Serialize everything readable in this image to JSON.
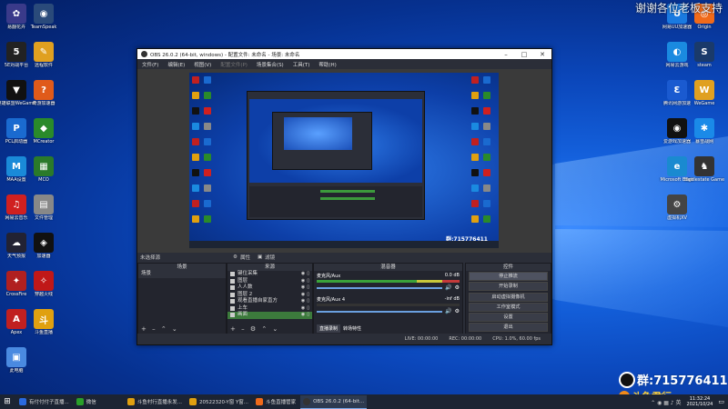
{
  "watermark": "谢谢各位老板支持",
  "left_icons": [
    {
      "label": "易翻花卉",
      "color": "#3a3a8a",
      "glyph": "✿"
    },
    {
      "label": "TeamSpeak",
      "color": "#2a4a7a",
      "glyph": "◉"
    },
    {
      "label": "5E对战平台",
      "color": "#222",
      "glyph": "5"
    },
    {
      "label": "远程软件",
      "color": "#e0a020",
      "glyph": "✎"
    },
    {
      "label": "英雄联盟WeGame",
      "color": "#111",
      "glyph": "▼"
    },
    {
      "label": "奇游加速器",
      "color": "#e05a1a",
      "glyph": "?"
    },
    {
      "label": "PCL启动器",
      "color": "#1a6ad0",
      "glyph": "P"
    },
    {
      "label": "MCreator",
      "color": "#2a8a2a",
      "glyph": "◆"
    },
    {
      "label": "MAA设置",
      "color": "#1a8ad8",
      "glyph": "M"
    },
    {
      "label": "MCO",
      "color": "#2a7a2a",
      "glyph": "▦"
    },
    {
      "label": "网易云音乐",
      "color": "#d02020",
      "glyph": "♫"
    },
    {
      "label": "文件管理",
      "color": "#888",
      "glyph": "▤"
    },
    {
      "label": "天气预报",
      "color": "#223",
      "glyph": "☁"
    },
    {
      "label": "加速器",
      "color": "#111",
      "glyph": "◈"
    },
    {
      "label": "CrossFire",
      "color": "#b02020",
      "glyph": "✦"
    },
    {
      "label": "穿越火线",
      "color": "#c01818",
      "glyph": "✧"
    },
    {
      "label": "Apex",
      "color": "#c02020",
      "glyph": "A"
    },
    {
      "label": "斗鱼直播",
      "color": "#e0a010",
      "glyph": "斗"
    },
    {
      "label": "此电脑",
      "color": "#4a8ae0",
      "glyph": "▣"
    }
  ],
  "right_icons": [
    {
      "label": "网易UU加速器",
      "color": "#1a7ae0",
      "glyph": "U"
    },
    {
      "label": "Origin",
      "color": "#f06a1a",
      "glyph": "◎"
    },
    {
      "label": "网易云游戏",
      "color": "#1a8ae0",
      "glyph": "◐"
    },
    {
      "label": "steam",
      "color": "#1a3a6a",
      "glyph": "S"
    },
    {
      "label": "腾讯网游加速",
      "color": "#1a5ad0",
      "glyph": "Ɛ"
    },
    {
      "label": "WeGame",
      "color": "#e0a020",
      "glyph": "W"
    },
    {
      "label": "爱游戏加速器",
      "color": "#111",
      "glyph": "◉"
    },
    {
      "label": "暴雪战网",
      "color": "#1a8ae8",
      "glyph": "✱"
    },
    {
      "label": "Microsoft Edge",
      "color": "#1a8ad0",
      "glyph": "e"
    },
    {
      "label": "Battlestate Games L...",
      "color": "#333",
      "glyph": "♞"
    },
    {
      "label": "虚拟机XV",
      "color": "#444",
      "glyph": "⚙"
    }
  ],
  "obs": {
    "title": "OBS 26.0.2 (64-bit, windows) - 配置文件: 未命名 - 场景: 未命名",
    "menu": [
      "文件(F)",
      "编辑(E)",
      "视图(V)",
      "配置文件(P)",
      "场景集合(S)",
      "工具(T)",
      "帮助(H)"
    ],
    "no_source": "未选择源",
    "props": "属性",
    "filters": "滤镜",
    "docks": {
      "scenes": "场景",
      "sources": "来源",
      "mixer": "混音器",
      "transitions": "转场",
      "controls": "控件"
    },
    "scenes": [
      "场景"
    ],
    "sources": [
      "键位采集",
      "图层",
      "人人数",
      "图层 2",
      "观看直播自家直方",
      "上车",
      "画面"
    ],
    "mixer": [
      {
        "name": "麦克风/Aux",
        "level": "0.0 dB"
      },
      {
        "name": "麦克风/Aux 4",
        "level": "-inf dB"
      }
    ],
    "mixer_tabs": [
      "直播录制",
      "转场特性"
    ],
    "controls": [
      "停止推流",
      "开始录制",
      "启动虚拟摄像机",
      "工作室模式",
      "设置",
      "退出"
    ],
    "status": {
      "live": "LIVE: 00:00:00",
      "rec": "REC: 00:00:00",
      "cpu": "CPU: 1.0%, 60.00 fps"
    }
  },
  "qq_overlay": "群:715776411",
  "douyu_overlay": "斗鱼君行",
  "taskbar": {
    "apps": [
      "有付付付子直播...",
      "微信",
      "斗鱼村行直播永发...",
      "20522320-Y窗 Y窗...",
      "斗鱼直播管家",
      "OBS 26.0.2 (64-bit..."
    ],
    "time": "11:32:24",
    "date": "2021/10/24"
  },
  "colors": {
    "accent": "#1a6ad0",
    "obs_bg": "#2b2e38",
    "desktop": "#0b47bb"
  }
}
